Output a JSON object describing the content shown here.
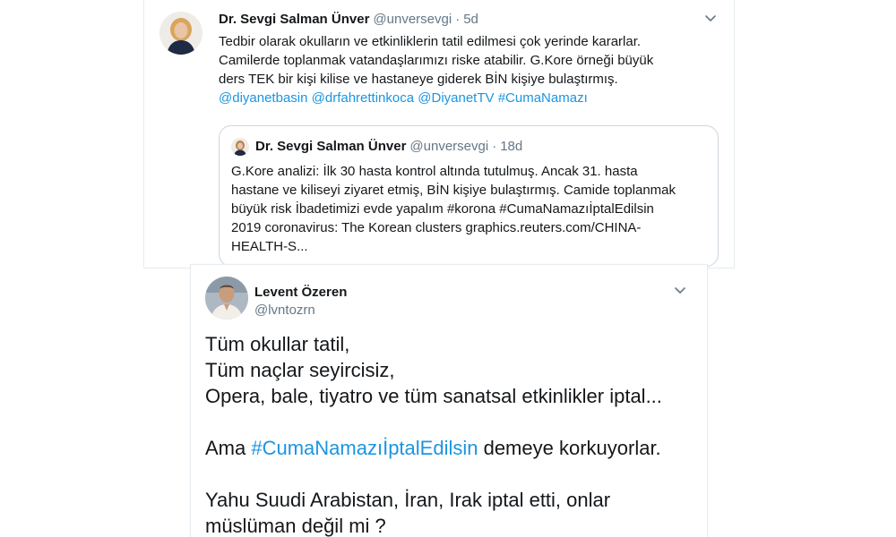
{
  "tweet1": {
    "author_name": "Dr. Sevgi Salman Ünver",
    "handle": "@unversevgi",
    "separator": "·",
    "time": "5d",
    "body_lines": [
      "Tedbir olarak okulların ve etkinliklerin tatil edilmesi çok yerinde kararlar.",
      "Camilerde toplanmak vatandaşlarımızı riske atabilir. G.Kore örneği büyük",
      "ders TEK bir kişi kilise ve hastaneye giderek BİN kişiye bulaştırmış."
    ],
    "mentions": [
      "@diyanetbasin",
      "@drfahrettinkoca",
      "@DiyanetTV",
      "#CumaNamazı"
    ],
    "quote": {
      "author_name": "Dr. Sevgi Salman Ünver",
      "handle": "@unversevgi",
      "separator": "·",
      "time": "18d",
      "body_lines": [
        "G.Kore  analizi: İlk 30 hasta kontrol altında tutulmuş. Ancak 31. hasta",
        "hastane ve kiliseyi ziyaret etmiş, BİN kişiye bulaştırmış. Camide toplanmak",
        "büyük risk İbadetimizi evde yapalım #korona #CumaNamazıİptalEdilsin",
        "2019 coronavirus: The Korean clusters graphics.reuters.com/CHINA-",
        "HEALTH-S..."
      ]
    }
  },
  "tweet2": {
    "author_name": "Levent Özeren",
    "handle": "@lvntozrn",
    "body_line_1": "Tüm okullar tatil,",
    "body_line_2": "Tüm naçlar seyircisiz,",
    "body_line_3": "Opera, bale, tiyatro ve tüm sanatsal etkinlikler iptal...",
    "body_line_4_prefix": "Ama ",
    "body_line_4_hashtag": "#CumaNamazıİptalEdilsin",
    "body_line_4_suffix": " demeye korkuyorlar.",
    "body_line_5": "Yahu Suudi Arabistan, İran, Irak iptal etti, onlar",
    "body_line_6": "müslüman değil mi ?"
  },
  "colors": {
    "link": "#1b95e0",
    "secondary_text": "#657786",
    "border": "#ccd6dd"
  },
  "icons": {
    "caret": "chevron-down-icon",
    "avatar": "avatar"
  }
}
